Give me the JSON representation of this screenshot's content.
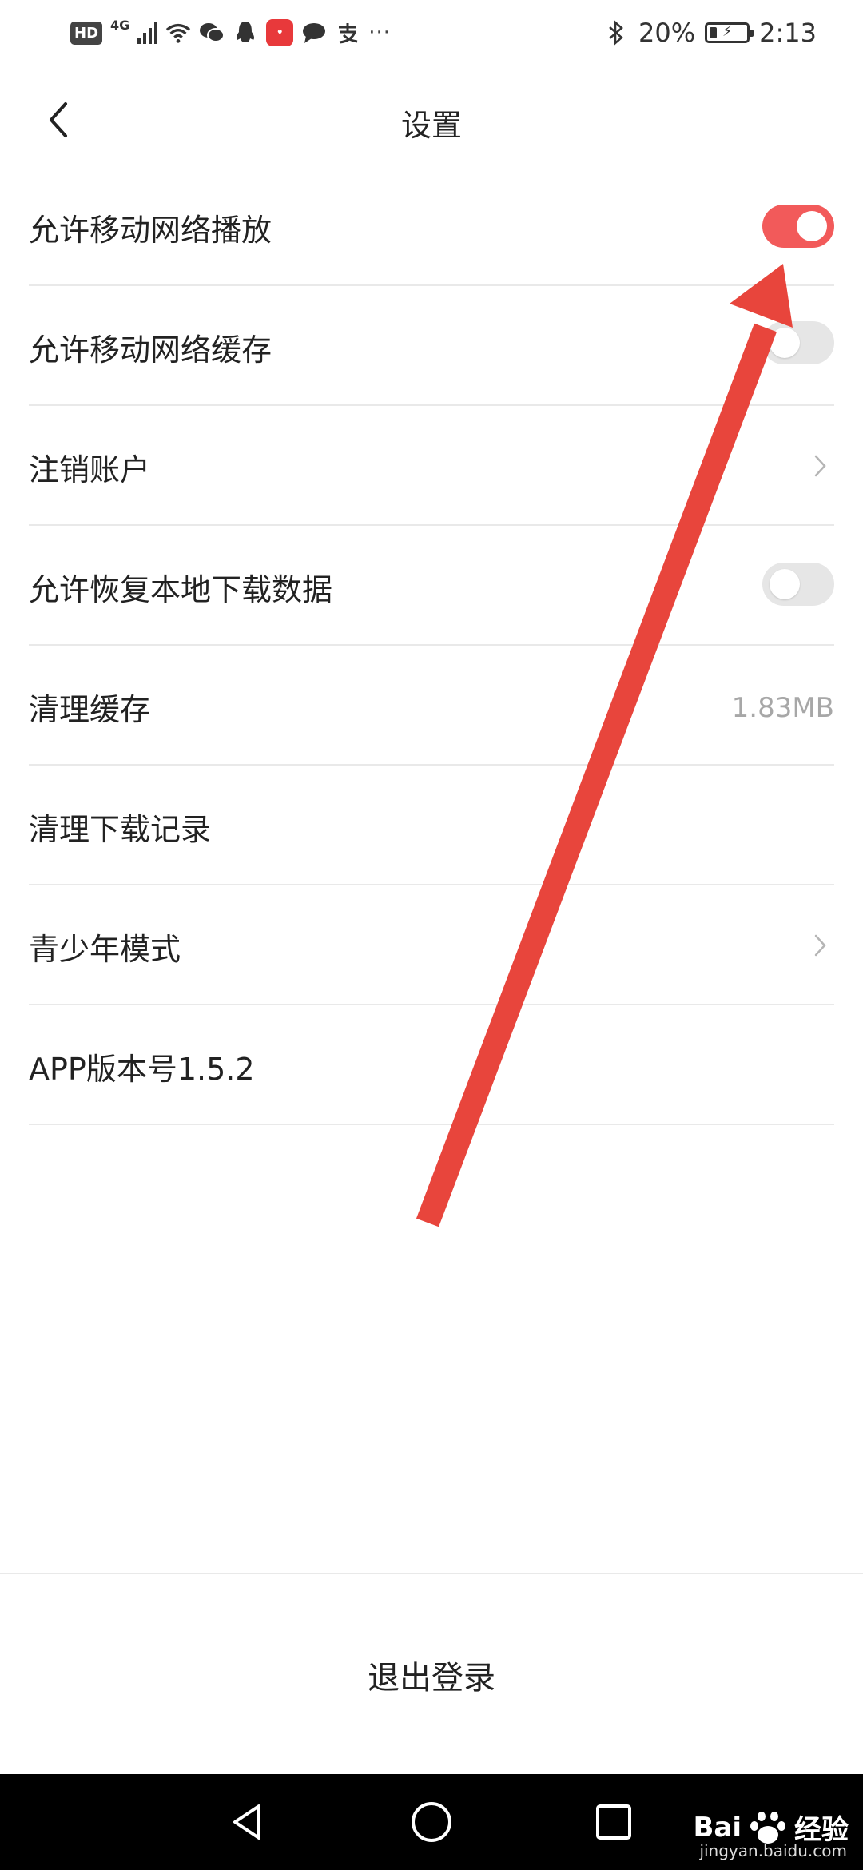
{
  "status_bar": {
    "hd": "HD",
    "network": "4G",
    "battery_percent": "20%",
    "battery_level": 0.2,
    "time": "2:13",
    "icons": [
      "wifi-icon",
      "wechat-icon",
      "qq-icon",
      "huawei-app-icon",
      "message-icon",
      "alipay-icon",
      "more-dots-icon",
      "bluetooth-icon",
      "battery-icon"
    ]
  },
  "header": {
    "title": "设置",
    "back_icon": "chevron-left-icon"
  },
  "settings": {
    "mobile_play": {
      "label": "允许移动网络播放",
      "enabled": true
    },
    "mobile_cache": {
      "label": "允许移动网络缓存",
      "enabled": false
    },
    "cancel_account": {
      "label": "注销账户"
    },
    "restore_local": {
      "label": "允许恢复本地下载数据",
      "enabled": false
    },
    "clear_cache": {
      "label": "清理缓存",
      "value": "1.83MB"
    },
    "clear_downloads": {
      "label": "清理下载记录"
    },
    "teen_mode": {
      "label": "青少年模式"
    },
    "version": {
      "label": "APP版本号1.5.2"
    }
  },
  "logout": {
    "label": "退出登录"
  },
  "watermark": {
    "text": "Bai",
    "text2": "经验",
    "sub": "jingyan.baidu.com"
  },
  "colors": {
    "accent": "#f25a5a",
    "toggle_off": "#e6e6e6",
    "annotation_arrow": "#e8453c",
    "muted_text": "#a7a7a7"
  }
}
